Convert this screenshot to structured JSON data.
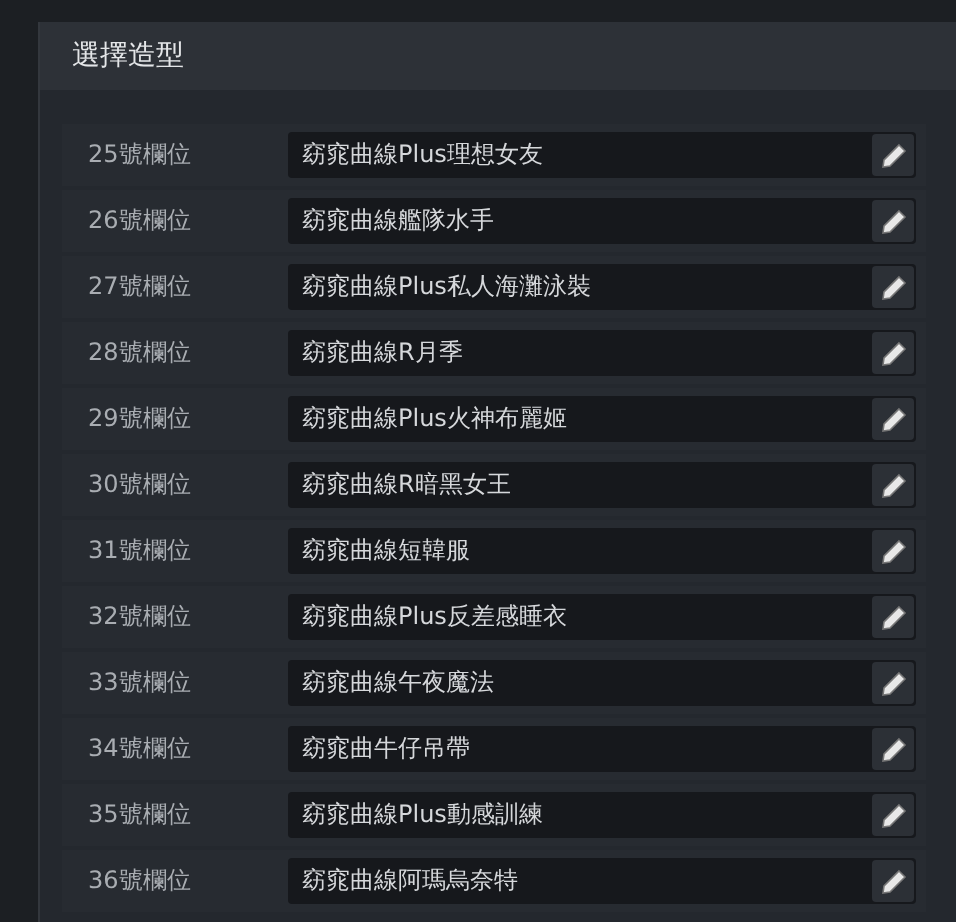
{
  "dialog": {
    "title": "選擇造型"
  },
  "slots": [
    {
      "label": "25號欄位",
      "value": "窈窕曲線Plus理想女友"
    },
    {
      "label": "26號欄位",
      "value": "窈窕曲線艦隊水手"
    },
    {
      "label": "27號欄位",
      "value": "窈窕曲線Plus私人海灘泳裝"
    },
    {
      "label": "28號欄位",
      "value": "窈窕曲線R月季"
    },
    {
      "label": "29號欄位",
      "value": "窈窕曲線Plus火神布麗姬"
    },
    {
      "label": "30號欄位",
      "value": "窈窕曲線R暗黑女王"
    },
    {
      "label": "31號欄位",
      "value": "窈窕曲線短韓服"
    },
    {
      "label": "32號欄位",
      "value": "窈窕曲線Plus反差感睡衣"
    },
    {
      "label": "33號欄位",
      "value": "窈窕曲線午夜魔法"
    },
    {
      "label": "34號欄位",
      "value": "窈窕曲牛仔吊帶"
    },
    {
      "label": "35號欄位",
      "value": "窈窕曲線Plus動感訓練"
    },
    {
      "label": "36號欄位",
      "value": "窈窕曲線阿瑪烏奈特"
    }
  ]
}
